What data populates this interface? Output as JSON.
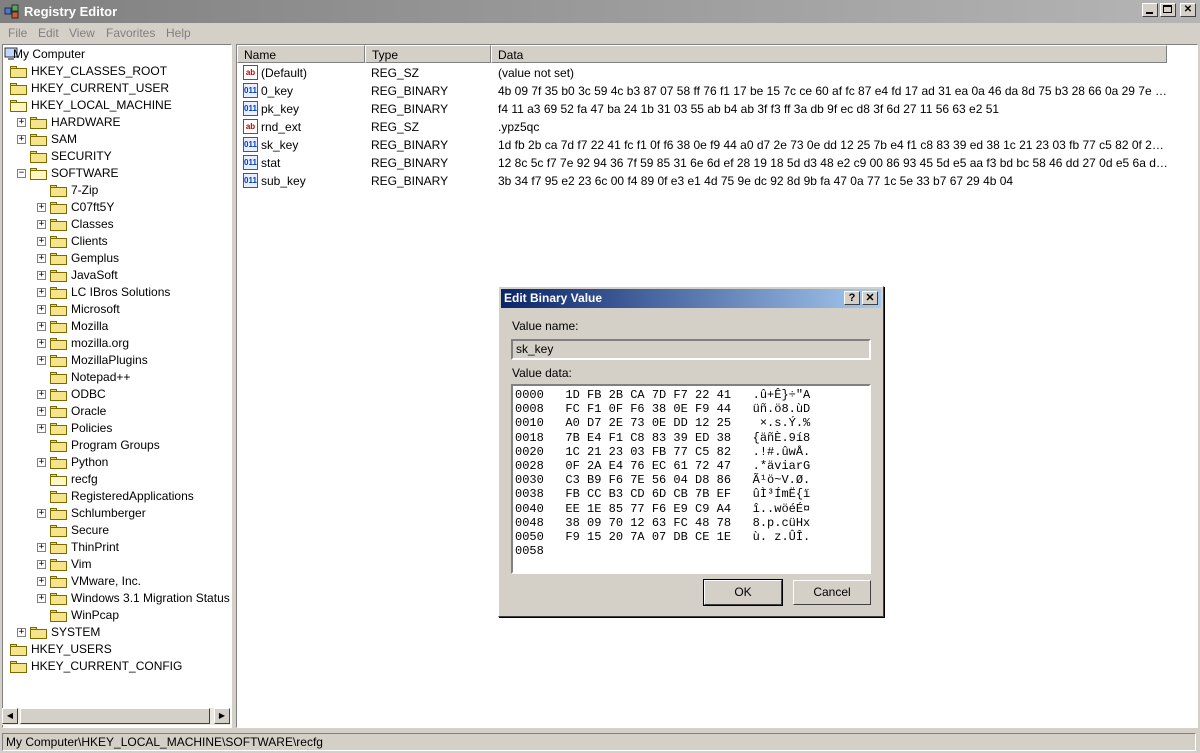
{
  "window": {
    "title": "Registry Editor"
  },
  "menu": [
    "File",
    "Edit",
    "View",
    "Favorites",
    "Help"
  ],
  "tree": [
    {
      "label": "My Computer",
      "depth": 0,
      "expander": "",
      "icon": "computer"
    },
    {
      "label": "HKEY_CLASSES_ROOT",
      "depth": 1,
      "expander": "+",
      "icon": "folder"
    },
    {
      "label": "HKEY_CURRENT_USER",
      "depth": 1,
      "expander": "+",
      "icon": "folder"
    },
    {
      "label": "HKEY_LOCAL_MACHINE",
      "depth": 1,
      "expander": "-",
      "icon": "folder-open"
    },
    {
      "label": "HARDWARE",
      "depth": 2,
      "expander": "+",
      "icon": "folder"
    },
    {
      "label": "SAM",
      "depth": 2,
      "expander": "+",
      "icon": "folder"
    },
    {
      "label": "SECURITY",
      "depth": 2,
      "expander": "",
      "icon": "folder"
    },
    {
      "label": "SOFTWARE",
      "depth": 2,
      "expander": "-",
      "icon": "folder-open"
    },
    {
      "label": "7-Zip",
      "depth": 3,
      "expander": "",
      "icon": "folder"
    },
    {
      "label": "C07ft5Y",
      "depth": 3,
      "expander": "+",
      "icon": "folder"
    },
    {
      "label": "Classes",
      "depth": 3,
      "expander": "+",
      "icon": "folder"
    },
    {
      "label": "Clients",
      "depth": 3,
      "expander": "+",
      "icon": "folder"
    },
    {
      "label": "Gemplus",
      "depth": 3,
      "expander": "+",
      "icon": "folder"
    },
    {
      "label": "JavaSoft",
      "depth": 3,
      "expander": "+",
      "icon": "folder"
    },
    {
      "label": "LC IBros Solutions",
      "depth": 3,
      "expander": "+",
      "icon": "folder"
    },
    {
      "label": "Microsoft",
      "depth": 3,
      "expander": "+",
      "icon": "folder"
    },
    {
      "label": "Mozilla",
      "depth": 3,
      "expander": "+",
      "icon": "folder"
    },
    {
      "label": "mozilla.org",
      "depth": 3,
      "expander": "+",
      "icon": "folder"
    },
    {
      "label": "MozillaPlugins",
      "depth": 3,
      "expander": "+",
      "icon": "folder"
    },
    {
      "label": "Notepad++",
      "depth": 3,
      "expander": "",
      "icon": "folder"
    },
    {
      "label": "ODBC",
      "depth": 3,
      "expander": "+",
      "icon": "folder"
    },
    {
      "label": "Oracle",
      "depth": 3,
      "expander": "+",
      "icon": "folder"
    },
    {
      "label": "Policies",
      "depth": 3,
      "expander": "+",
      "icon": "folder"
    },
    {
      "label": "Program Groups",
      "depth": 3,
      "expander": "",
      "icon": "folder"
    },
    {
      "label": "Python",
      "depth": 3,
      "expander": "+",
      "icon": "folder"
    },
    {
      "label": "recfg",
      "depth": 3,
      "expander": "",
      "icon": "folder-open"
    },
    {
      "label": "RegisteredApplications",
      "depth": 3,
      "expander": "",
      "icon": "folder"
    },
    {
      "label": "Schlumberger",
      "depth": 3,
      "expander": "+",
      "icon": "folder"
    },
    {
      "label": "Secure",
      "depth": 3,
      "expander": "",
      "icon": "folder"
    },
    {
      "label": "ThinPrint",
      "depth": 3,
      "expander": "+",
      "icon": "folder"
    },
    {
      "label": "Vim",
      "depth": 3,
      "expander": "+",
      "icon": "folder"
    },
    {
      "label": "VMware, Inc.",
      "depth": 3,
      "expander": "+",
      "icon": "folder"
    },
    {
      "label": "Windows 3.1 Migration Status",
      "depth": 3,
      "expander": "+",
      "icon": "folder"
    },
    {
      "label": "WinPcap",
      "depth": 3,
      "expander": "",
      "icon": "folder"
    },
    {
      "label": "SYSTEM",
      "depth": 2,
      "expander": "+",
      "icon": "folder"
    },
    {
      "label": "HKEY_USERS",
      "depth": 1,
      "expander": "+",
      "icon": "folder"
    },
    {
      "label": "HKEY_CURRENT_CONFIG",
      "depth": 1,
      "expander": "+",
      "icon": "folder"
    }
  ],
  "list": {
    "columns": [
      "Name",
      "Type",
      "Data"
    ],
    "rows": [
      {
        "name": "(Default)",
        "type": "REG_SZ",
        "data": "(value not set)",
        "icon": "ab"
      },
      {
        "name": "0_key",
        "type": "REG_BINARY",
        "data": "4b 09 7f 35 b0 3c 59 4c b3 87 07 58 ff 76 f1 17 be 15 7c ce 60 af fc 87 e4 fd 17 ad 31 ea 0a 46 da 8d 75 b3 28 66 0a 29 7e 70 ...",
        "icon": "011"
      },
      {
        "name": "pk_key",
        "type": "REG_BINARY",
        "data": "f4 11 a3 69 52 fa 47 ba 24 1b 31 03 55 ab b4 ab 3f f3 ff 3a db 9f ec d8 3f 6d 27 11 56 63 e2 51",
        "icon": "011"
      },
      {
        "name": "rnd_ext",
        "type": "REG_SZ",
        "data": ".ypz5qc",
        "icon": "ab"
      },
      {
        "name": "sk_key",
        "type": "REG_BINARY",
        "data": "1d fb 2b ca 7d f7 22 41 fc f1 0f f6 38 0e f9 44 a0 d7 2e 73 0e dd 12 25 7b e4 f1 c8 83 39 ed 38 1c 21 23 03 fb 77 c5 82 0f 2a e...",
        "icon": "011"
      },
      {
        "name": "stat",
        "type": "REG_BINARY",
        "data": "12 8c 5c f7 7e 92 94 36 7f 59 85 31 6e 6d ef 28 19 18 5d d3 48 e2 c9 00 86 93 45 5d e5 aa f3 bd bc 58 46 dd 27 0d e5 6a d0 f1...",
        "icon": "011"
      },
      {
        "name": "sub_key",
        "type": "REG_BINARY",
        "data": "3b 34 f7 95 e2 23 6c 00 f4 89 0f e3 e1 4d 75 9e dc 92 8d 9b fa 47 0a 77 1c 5e 33 b7 67 29 4b 04",
        "icon": "011"
      }
    ]
  },
  "status": {
    "path": "My Computer\\HKEY_LOCAL_MACHINE\\SOFTWARE\\recfg"
  },
  "dialog": {
    "title": "Edit Binary Value",
    "help_glyph": "?",
    "close_glyph": "✕",
    "value_name_label": "Value name:",
    "value_name": "sk_key",
    "value_data_label": "Value data:",
    "hex_lines": [
      "0000   1D FB 2B CA 7D F7 22 41   .û+Ê}÷\"A",
      "0008   FC F1 0F F6 38 0E F9 44   üñ.ö8.ùD",
      "0010   A0 D7 2E 73 0E DD 12 25    ×.s.Ý.%",
      "0018   7B E4 F1 C8 83 39 ED 38   {äñÈ.9í8",
      "0020   1C 21 23 03 FB 77 C5 82   .!#.ûwÅ.",
      "0028   0F 2A E4 76 EC 61 72 47   .*äviarG",
      "0030   C3 B9 F6 7E 56 04 D8 86   Ã¹ö~V.Ø.",
      "0038   FB CC B3 CD 6D CB 7B EF   ûÌ³ÍmË{ï",
      "0040   EE 1E 85 77 F6 E9 C9 A4   î..wöéÉ¤",
      "0048   38 09 70 12 63 FC 48 78   8.p.cüHx",
      "0050   F9 15 20 7A 07 DB CE 1E   ù. z.ÛÎ.",
      "0058"
    ],
    "ok_label": "OK",
    "cancel_label": "Cancel"
  }
}
